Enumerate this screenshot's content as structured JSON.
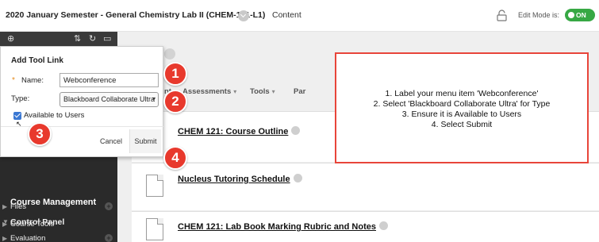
{
  "header": {
    "course_title": "2020 January Semester - General Chemistry Lab II (CHEM-121-L1)",
    "content_link": "Content",
    "edit_mode_label": "Edit Mode is:",
    "edit_mode_state": "ON"
  },
  "menu_toolbar": {
    "icons": [
      "add-icon",
      "sort-icon",
      "refresh-icon",
      "folder-icon"
    ]
  },
  "dialog": {
    "title": "Add Tool Link",
    "required_marker": "*",
    "name_label": "Name:",
    "name_value": "Webconference",
    "type_label": "Type:",
    "type_value": "Blackboard Collaborate Ultra",
    "available_label": "Available to Users",
    "available_checked": true,
    "cancel_label": "Cancel",
    "submit_label": "Submit"
  },
  "bubbles": [
    "1",
    "2",
    "3",
    "4"
  ],
  "tabs": [
    {
      "label": "nt"
    },
    {
      "label": "Assessments"
    },
    {
      "label": "Tools"
    },
    {
      "label": "Par"
    }
  ],
  "course_management": {
    "title": "Course Management",
    "control_panel": "Control Panel",
    "items": [
      "Files",
      "Course Tools",
      "Evaluation"
    ]
  },
  "content_items": [
    {
      "title": "CHEM 121: Course Outline"
    },
    {
      "title": "Nucleus Tutoring Schedule"
    },
    {
      "title": "CHEM 121: Lab Book Marking Rubric and Notes"
    }
  ],
  "callout": {
    "lines": [
      "1. Label your menu item 'Webconference'",
      "2. Select 'Blackboard Collaborate Ultra' for Type",
      "3. Ensure it is Available to Users",
      "4. Select Submit"
    ]
  },
  "colors": {
    "accent_red": "#e8392d",
    "toggle_green": "#37a844",
    "checkbox_blue": "#3a78d3",
    "panel_dark": "#2a2a2a"
  }
}
